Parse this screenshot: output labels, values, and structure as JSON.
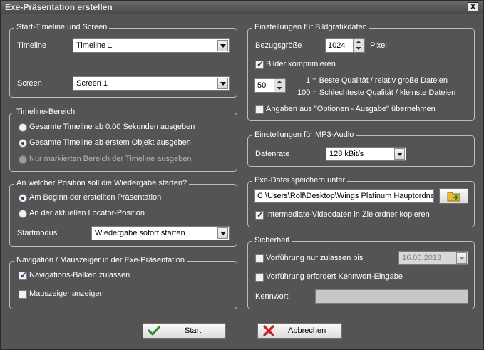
{
  "window": {
    "title": "Exe-Präsentation erstellen",
    "close_label": "x"
  },
  "start_timeline": {
    "legend": "Start-Timeline und Screen",
    "timeline_label": "Timeline",
    "timeline_value": "Timeline 1",
    "screen_label": "Screen",
    "screen_value": "Screen 1"
  },
  "timeline_range": {
    "legend": "Timeline-Bereich",
    "options": [
      {
        "label": "Gesamte Timeline ab 0.00 Sekunden ausgeben",
        "selected": false,
        "enabled": true
      },
      {
        "label": "Gesamte Timeline ab erstem Objekt ausgeben",
        "selected": true,
        "enabled": true
      },
      {
        "label": "Nur markierten Bereich der Timeline ausgeben",
        "selected": false,
        "enabled": false
      }
    ]
  },
  "start_position": {
    "legend": "An welcher Position soll die Wiedergabe starten?",
    "options": [
      {
        "label": "Am Beginn der erstellten Präsentation",
        "selected": true
      },
      {
        "label": "An der aktuellen Locator-Position",
        "selected": false
      }
    ],
    "startmode_label": "Startmodus",
    "startmode_value": "Wiedergabe sofort starten"
  },
  "navigation": {
    "legend": "Navigation / Mauszeiger in der Exe-Präsentation",
    "nav_bar_label": "Navigations-Balken zulassen",
    "nav_bar_checked": true,
    "cursor_label": "Mauszeiger anzeigen",
    "cursor_checked": false
  },
  "image_settings": {
    "legend": "Einstellungen für Bildgrafikdaten",
    "ref_size_label": "Bezugsgröße",
    "ref_size_value": "1024",
    "ref_size_unit": "Pixel",
    "compress_label": "Bilder komprimieren",
    "compress_checked": true,
    "quality_value": "50",
    "quality_hint_1": "1 = Beste Qualität / relativ große Dateien",
    "quality_hint_2": "100 = Schlechteste Qualität / kleinste Dateien",
    "options_label": "Angaben aus \"Optionen - Ausgabe\" übernehmen",
    "options_checked": false
  },
  "mp3": {
    "legend": "Einstellungen für MP3-Audio",
    "bitrate_label": "Datenrate",
    "bitrate_value": "128 kBit/s"
  },
  "save": {
    "legend": "Exe-Datei speichern unter",
    "path_value": "C:\\Users\\Rolf\\Desktop\\Wings Platinum Hauptordne",
    "intermediate_label": "Intermediate-Videodaten in Zielordner kopieren",
    "intermediate_checked": true
  },
  "security": {
    "legend": "Sicherheit",
    "until_label": "Vorführung nur zulassen bis",
    "until_checked": false,
    "date_value": "16.06.2013",
    "password_required_label": "Vorführung erfordert Kennwort-Eingabe",
    "password_required_checked": false,
    "password_label": "Kennwort",
    "password_value": ""
  },
  "buttons": {
    "start_label": "Start",
    "cancel_label": "Abbrechen"
  },
  "colors": {
    "background": "#545454",
    "ok_icon": "#2e8b2e",
    "cancel_icon": "#c82020",
    "folder_icon": "#e8b83c"
  }
}
